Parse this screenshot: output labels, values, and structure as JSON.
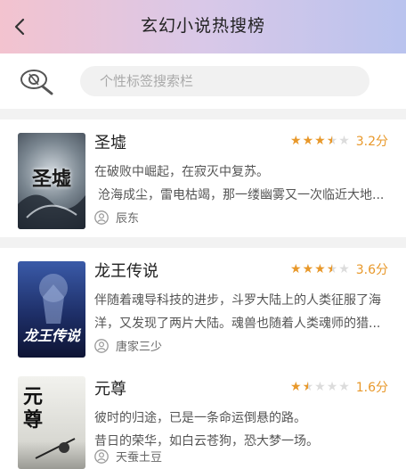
{
  "header": {
    "title": "玄幻小说热搜榜",
    "back_icon": "chevron-left-icon"
  },
  "search": {
    "icon": "search-tag-icon",
    "placeholder": "个性标签搜索栏"
  },
  "colors": {
    "star": "#e8982a",
    "star_empty": "#dcdcdc",
    "rating": "#e8982a"
  },
  "books": [
    {
      "title": "圣墟",
      "rating_text": "3.2分",
      "rating": 3.5,
      "desc": [
        "在破败中崛起，在寂灭中复苏。",
        "沧海成尘，雷电枯竭，那一缕幽雾又一次临近大地..."
      ],
      "author": "辰东",
      "cover_text": "圣墟"
    },
    {
      "title": "龙王传说",
      "rating_text": "3.6分",
      "rating": 3.5,
      "desc": [
        "伴随着魂导科技的进步，斗罗大陆上的人类征服了海",
        "洋，又发现了两片大陆。魂兽也随着人类魂师的猎..."
      ],
      "author": "唐家三少",
      "cover_text": "龙王传说"
    },
    {
      "title": "元尊",
      "rating_text": "1.6分",
      "rating": 1.5,
      "desc": [
        "彼时的归途，已是一条命运倒悬的路。",
        "昔日的荣华，如白云苍狗，恐大梦一场。"
      ],
      "author": "天蚕土豆",
      "cover_text": "元尊"
    }
  ]
}
